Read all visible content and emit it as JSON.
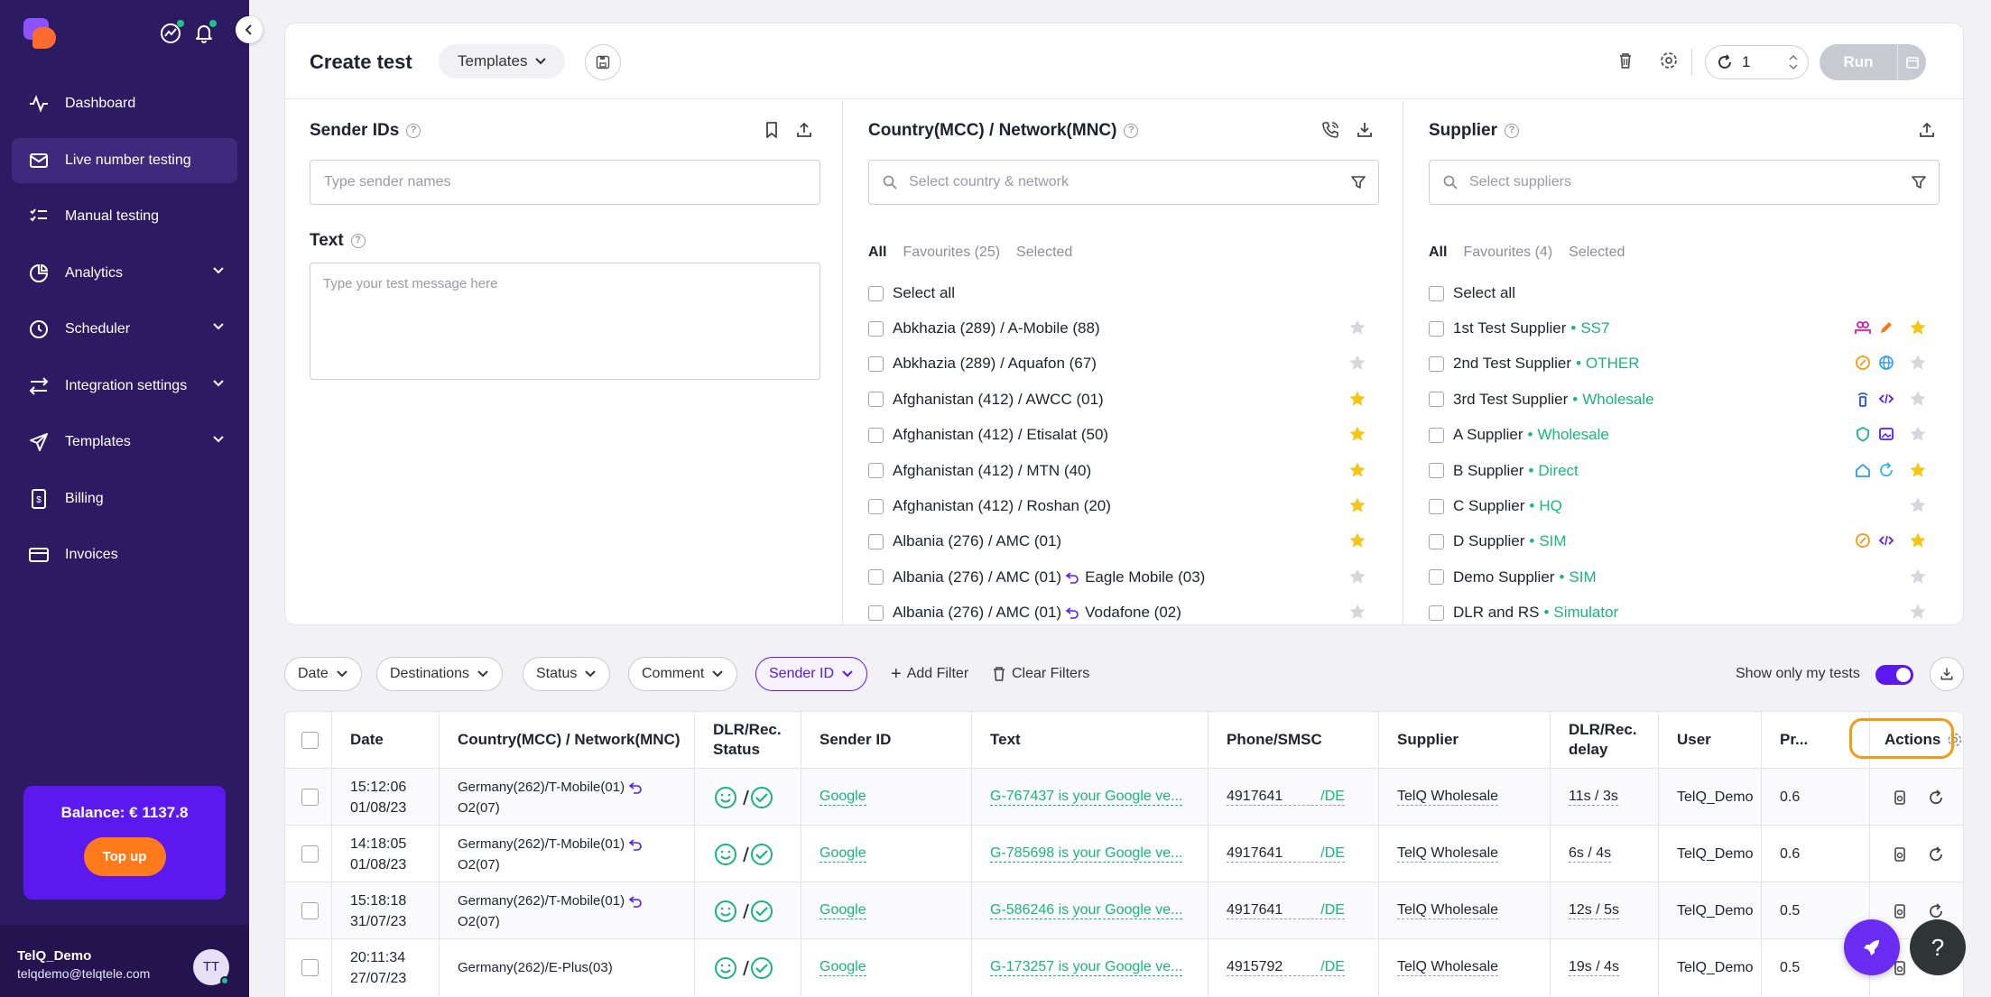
{
  "sidebar": {
    "items": [
      {
        "label": "Dashboard",
        "icon": "activity-icon",
        "has_chevron": false,
        "active": false
      },
      {
        "label": "Live number testing",
        "icon": "mail-icon",
        "has_chevron": false,
        "active": true
      },
      {
        "label": "Manual testing",
        "icon": "checklist-icon",
        "has_chevron": false,
        "active": false
      },
      {
        "label": "Analytics",
        "icon": "pie-chart-icon",
        "has_chevron": true,
        "active": false
      },
      {
        "label": "Scheduler",
        "icon": "clock-icon",
        "has_chevron": true,
        "active": false
      },
      {
        "label": "Integration settings",
        "icon": "arrows-swap-icon",
        "has_chevron": true,
        "active": false
      },
      {
        "label": "Templates",
        "icon": "send-icon",
        "has_chevron": true,
        "active": false
      },
      {
        "label": "Billing",
        "icon": "billing-icon",
        "has_chevron": false,
        "active": false
      },
      {
        "label": "Invoices",
        "icon": "card-icon",
        "has_chevron": false,
        "active": false
      }
    ],
    "balance_label": "Balance: € 1137.8",
    "topup_label": "Top up",
    "user_name": "TelQ_Demo",
    "user_email": "telqdemo@telqtele.com",
    "avatar_initials": "TT"
  },
  "header": {
    "title": "Create test",
    "templates_label": "Templates",
    "repeat_value": "1",
    "run_label": "Run"
  },
  "sender": {
    "title": "Sender IDs",
    "placeholder": "Type sender names",
    "text_title": "Text",
    "text_placeholder": "Type your test message here"
  },
  "network": {
    "title": "Country(MCC) / Network(MNC)",
    "placeholder": "Select country & network",
    "tabs": [
      "All",
      "Favourites (25)",
      "Selected"
    ],
    "select_all": "Select all",
    "items": [
      {
        "label": "Abkhazia (289) / A-Mobile (88)",
        "fav": false
      },
      {
        "label": "Abkhazia (289) / Aquafon (67)",
        "fav": false
      },
      {
        "label": "Afghanistan (412) / AWCC (01)",
        "fav": true
      },
      {
        "label": "Afghanistan (412) / Etisalat (50)",
        "fav": true
      },
      {
        "label": "Afghanistan (412) / MTN (40)",
        "fav": true
      },
      {
        "label": "Afghanistan (412) / Roshan (20)",
        "fav": true
      },
      {
        "label": "Albania (276) / AMC (01)",
        "fav": true
      },
      {
        "label": "Albania (276) / AMC (01)",
        "ported": "Eagle Mobile (03)",
        "fav": false
      },
      {
        "label": "Albania (276) / AMC (01)",
        "ported": "Vodafone (02)",
        "fav": false
      }
    ]
  },
  "supplier": {
    "title": "Supplier",
    "placeholder": "Select suppliers",
    "tabs": [
      "All",
      "Favourites (4)",
      "Selected"
    ],
    "select_all": "Select all",
    "items": [
      {
        "name": "1st Test Supplier",
        "type": "SS7",
        "fav": true,
        "tags": [
          "users-icon",
          "pen-icon"
        ]
      },
      {
        "name": "2nd Test Supplier",
        "type": "OTHER",
        "fav": false,
        "tags": [
          "badge-icon",
          "globe-icon"
        ]
      },
      {
        "name": "3rd Test Supplier",
        "type": "Wholesale",
        "fav": false,
        "tags": [
          "signal-icon",
          "code-icon"
        ]
      },
      {
        "name": "A Supplier",
        "type": "Wholesale",
        "fav": false,
        "tags": [
          "shield-icon",
          "image-icon"
        ]
      },
      {
        "name": "B Supplier",
        "type": "Direct",
        "fav": true,
        "tags": [
          "home-icon",
          "refresh-icon"
        ]
      },
      {
        "name": "C Supplier",
        "type": "HQ",
        "fav": false,
        "tags": []
      },
      {
        "name": "D Supplier",
        "type": "SIM",
        "fav": true,
        "tags": [
          "badge-icon",
          "code-icon"
        ]
      },
      {
        "name": "Demo Supplier",
        "type": "SIM",
        "fav": false,
        "tags": []
      },
      {
        "name": "DLR and RS",
        "type": "Simulator",
        "fav": false,
        "tags": []
      }
    ]
  },
  "filters": {
    "chips": [
      "Date",
      "Destinations",
      "Status",
      "Comment",
      "Sender ID"
    ],
    "add_filter": "Add Filter",
    "clear_filters": "Clear Filters",
    "show_only_label": "Show only my tests"
  },
  "table": {
    "columns": [
      "Date",
      "Country(MCC) / Network(MNC)",
      "DLR/Rec. Status",
      "Sender ID",
      "Text",
      "Phone/SMSC",
      "Supplier",
      "DLR/Rec. delay",
      "User",
      "Pr...",
      "Actions"
    ],
    "rows": [
      {
        "time": "15:12:06",
        "date": "01/08/23",
        "network": "Germany(262)/T-Mobile(01)",
        "ported": "O2(07)",
        "sender": "Google",
        "text": "G-767437 is your Google ve...",
        "phone": "4917641",
        "smsc": "/DE",
        "supplier": "TelQ Wholesale",
        "delay": "11s / 3s",
        "user": "TelQ_Demo",
        "price": "0.6"
      },
      {
        "time": "14:18:05",
        "date": "01/08/23",
        "network": "Germany(262)/T-Mobile(01)",
        "ported": "O2(07)",
        "sender": "Google",
        "text": "G-785698 is your Google ve...",
        "phone": "4917641",
        "smsc": "/DE",
        "supplier": "TelQ Wholesale",
        "delay": "6s / 4s",
        "user": "TelQ_Demo",
        "price": "0.6"
      },
      {
        "time": "15:18:18",
        "date": "31/07/23",
        "network": "Germany(262)/T-Mobile(01)",
        "ported": "O2(07)",
        "sender": "Google",
        "text": "G-586246 is your Google ve...",
        "phone": "4917641",
        "smsc": "/DE",
        "supplier": "TelQ Wholesale",
        "delay": "12s / 5s",
        "user": "TelQ_Demo",
        "price": "0.5"
      },
      {
        "time": "20:11:34",
        "date": "27/07/23",
        "network": "Germany(262)/E-Plus(03)",
        "ported": "",
        "sender": "Google",
        "text": "G-173257 is your Google ve...",
        "phone": "4915792",
        "smsc": "/DE",
        "supplier": "TelQ Wholesale",
        "delay": "19s / 4s",
        "user": "TelQ_Demo",
        "price": "0.5"
      }
    ]
  },
  "colors": {
    "sidebar": "#2c1a63",
    "accent": "#5b19ef",
    "green": "#19b67a",
    "star": "#f5c518",
    "orange": "#ff7a1a"
  }
}
